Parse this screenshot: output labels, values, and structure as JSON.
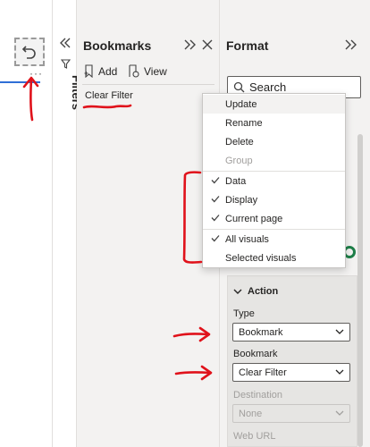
{
  "filters": {
    "label": "Filters"
  },
  "canvas": {
    "more_label": "···"
  },
  "bookmarks": {
    "title": "Bookmarks",
    "add_label": "Add",
    "view_label": "View",
    "items": [
      {
        "label": "Clear Filter"
      }
    ]
  },
  "format": {
    "title": "Format",
    "search_placeholder": "Search",
    "action": {
      "header": "Action",
      "type_label": "Type",
      "type_value": "Bookmark",
      "bookmark_label": "Bookmark",
      "bookmark_value": "Clear Filter",
      "destination_label": "Destination",
      "destination_value": "None",
      "web_url_label": "Web URL"
    }
  },
  "context_menu": {
    "items": [
      {
        "label": "Update",
        "state": "hover"
      },
      {
        "label": "Rename"
      },
      {
        "label": "Delete"
      },
      {
        "label": "Group",
        "state": "disabled"
      },
      {
        "label": "Data",
        "checked": true
      },
      {
        "label": "Display",
        "checked": true
      },
      {
        "label": "Current page",
        "checked": true
      },
      {
        "label": "All visuals",
        "checked": true
      },
      {
        "label": "Selected visuals",
        "checked": false
      }
    ]
  },
  "colors": {
    "annotation_red": "#e0121b",
    "accent_blue": "#2f6fd6",
    "pane_bg": "#f3f2f1",
    "success_green": "#1e7f48"
  },
  "icons": {
    "reset": "undo-arrow-icon",
    "collapse": "double-chevron-left-icon",
    "expand": "double-chevron-right-icon",
    "close": "close-icon",
    "funnel": "funnel-icon",
    "add": "bookmark-add-icon",
    "view": "view-icon",
    "search": "search-icon",
    "chevron_down": "chevron-down-icon",
    "check": "checkmark-icon"
  }
}
